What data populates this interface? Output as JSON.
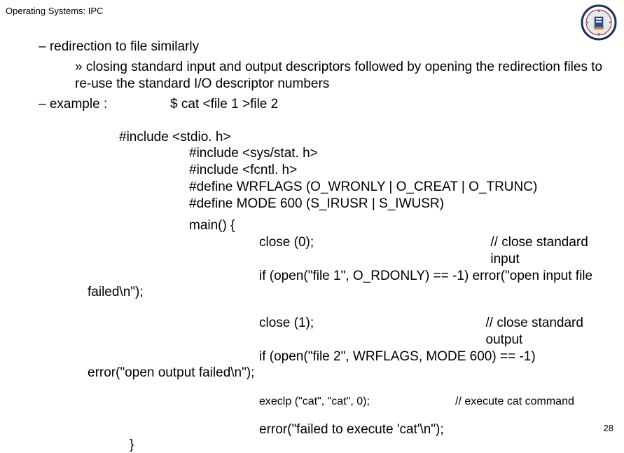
{
  "header": "Operating Systems: IPC",
  "bullet1": "– redirection to file similarly",
  "subBullet": "» closing standard input and output descriptors followed by opening  the redirection files to re-use the standard I/O descriptor numbers",
  "exampleLabel": "– example :",
  "cmd": "$ cat  <file 1  >file 2",
  "code": {
    "include1": "#include <stdio. h>",
    "include2": "#include <sys/stat. h>",
    "include3": "#include <fcntl. h>",
    "define1": "#define WRFLAGS (O_WRONLY | O_CREAT | O_TRUNC)",
    "define2": "#define MODE 600 (S_IRUSR | S_IWUSR)",
    "main": "main() {",
    "close0": "close (0);",
    "close0Comment": "// close standard input",
    "ifOpen1": "if (open(\"file 1\", O_RDONLY) == -1) error(\"open input file",
    "failed": "failed\\n\");",
    "close1": "close (1);",
    "close1Comment": "// close standard output",
    "ifOpen2": "if (open(\"file 2\", WRFLAGS, MODE 600) == -1)",
    "errOutput": "error(\"open output failed\\n\");",
    "execlp": "execlp (\"cat\", \"cat\", 0);",
    "execComment": "// execute cat command",
    "errFinal": "error(\"failed to execute 'cat'\\n\");",
    "closeBrace": "}"
  },
  "pageNum": "28"
}
